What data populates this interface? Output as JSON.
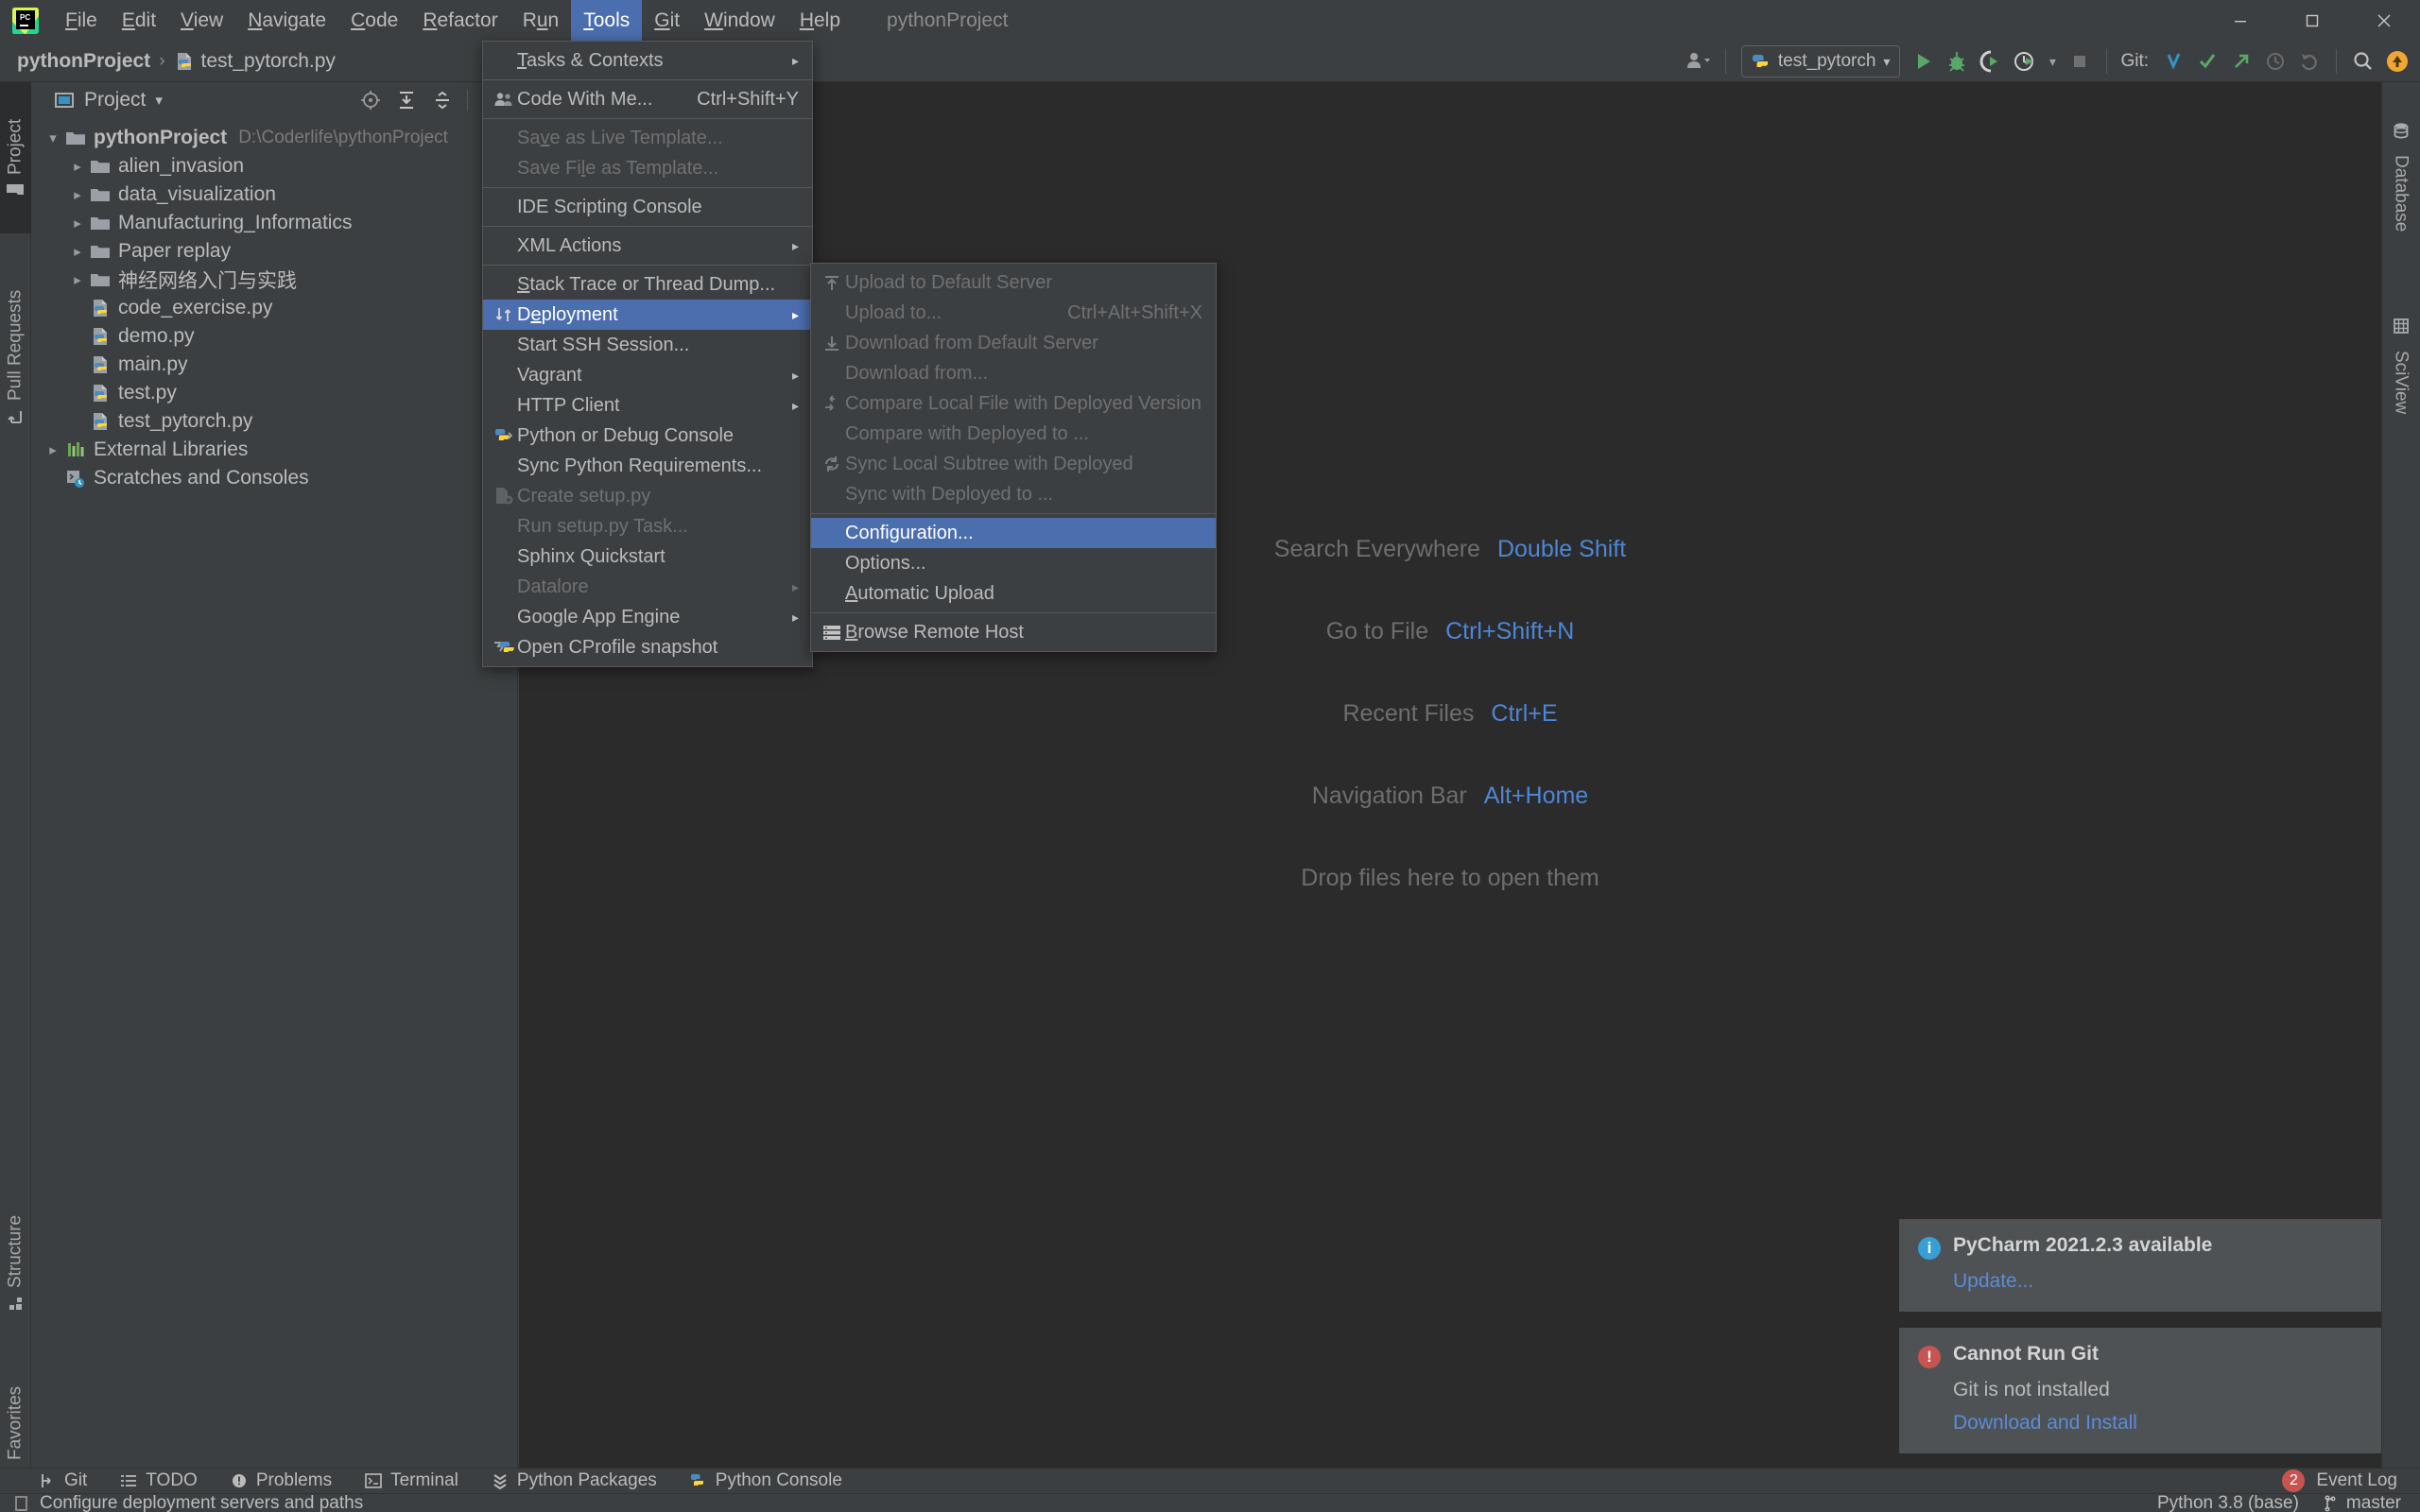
{
  "window": {
    "title": "pythonProject",
    "controls": [
      "minimize",
      "maximize",
      "close"
    ]
  },
  "menubar": {
    "items": [
      {
        "label": "File",
        "mnemonic": "F",
        "active": false
      },
      {
        "label": "Edit",
        "mnemonic": "E",
        "active": false
      },
      {
        "label": "View",
        "mnemonic": "V",
        "active": false
      },
      {
        "label": "Navigate",
        "mnemonic": "N",
        "active": false
      },
      {
        "label": "Code",
        "mnemonic": "C",
        "active": false
      },
      {
        "label": "Refactor",
        "mnemonic": "R",
        "active": false
      },
      {
        "label": "Run",
        "mnemonic": "u",
        "active": false
      },
      {
        "label": "Tools",
        "mnemonic": "T",
        "active": true
      },
      {
        "label": "Git",
        "mnemonic": "G",
        "active": false
      },
      {
        "label": "Window",
        "mnemonic": "W",
        "active": false
      },
      {
        "label": "Help",
        "mnemonic": "H",
        "active": false
      }
    ]
  },
  "breadcrumb": {
    "project": "pythonProject",
    "separator": "›",
    "file": "test_pytorch.py"
  },
  "toolbar": {
    "run_config": "test_pytorch",
    "git_label": "Git:",
    "icons": [
      "user-dropdown-icon",
      "run-icon",
      "debug-icon",
      "coverage-icon",
      "profile-icon",
      "stop-icon",
      "git-update-icon",
      "git-commit-icon",
      "git-push-icon",
      "git-history-icon",
      "git-rollback-icon",
      "search-everywhere-icon",
      "notifications-icon"
    ]
  },
  "left_strip": {
    "tabs": [
      {
        "label": "Project",
        "icon": "folder-icon",
        "selected": true
      },
      {
        "label": "Pull Requests",
        "icon": "pull-request-icon",
        "selected": false
      },
      {
        "label": "Structure",
        "icon": "structure-icon",
        "selected": false
      },
      {
        "label": "Favorites",
        "icon": "star-icon",
        "selected": false
      }
    ]
  },
  "right_strip": {
    "tabs": [
      {
        "label": "Database",
        "icon": "database-icon"
      },
      {
        "label": "SciView",
        "icon": "sciview-icon"
      }
    ]
  },
  "project_panel": {
    "header": "Project",
    "tools": [
      "locate-icon",
      "expand-all-icon",
      "collapse-all-icon",
      "settings-icon"
    ],
    "tree": [
      {
        "indent": 0,
        "arrow": "down",
        "icon": "folder-icon",
        "label": "pythonProject",
        "bold": true,
        "path": "D:\\Coderlife\\pythonProject"
      },
      {
        "indent": 1,
        "arrow": "right",
        "icon": "folder-icon",
        "label": "alien_invasion",
        "bold": false,
        "path": ""
      },
      {
        "indent": 1,
        "arrow": "right",
        "icon": "folder-icon",
        "label": "data_visualization",
        "bold": false,
        "path": ""
      },
      {
        "indent": 1,
        "arrow": "right",
        "icon": "folder-icon",
        "label": "Manufacturing_Informatics",
        "bold": false,
        "path": ""
      },
      {
        "indent": 1,
        "arrow": "right",
        "icon": "folder-icon",
        "label": "Paper replay",
        "bold": false,
        "path": ""
      },
      {
        "indent": 1,
        "arrow": "right",
        "icon": "folder-icon",
        "label": "神经网络入门与实践",
        "bold": false,
        "path": ""
      },
      {
        "indent": 1,
        "arrow": "none",
        "icon": "python-file-icon",
        "label": "code_exercise.py",
        "bold": false,
        "path": ""
      },
      {
        "indent": 1,
        "arrow": "none",
        "icon": "python-file-icon",
        "label": "demo.py",
        "bold": false,
        "path": ""
      },
      {
        "indent": 1,
        "arrow": "none",
        "icon": "python-file-icon",
        "label": "main.py",
        "bold": false,
        "path": ""
      },
      {
        "indent": 1,
        "arrow": "none",
        "icon": "python-file-icon",
        "label": "test.py",
        "bold": false,
        "path": ""
      },
      {
        "indent": 1,
        "arrow": "none",
        "icon": "python-file-icon",
        "label": "test_pytorch.py",
        "bold": false,
        "path": ""
      },
      {
        "indent": 0,
        "arrow": "right",
        "icon": "library-icon",
        "label": "External Libraries",
        "bold": false,
        "path": ""
      },
      {
        "indent": 0,
        "arrow": "none",
        "icon": "scratches-icon",
        "label": "Scratches and Consoles",
        "bold": false,
        "path": ""
      }
    ]
  },
  "editor_hints": [
    {
      "label": "Search Everywhere",
      "key": "Double Shift"
    },
    {
      "label": "Go to File",
      "key": "Ctrl+Shift+N"
    },
    {
      "label": "Recent Files",
      "key": "Ctrl+E"
    },
    {
      "label": "Navigation Bar",
      "key": "Alt+Home"
    },
    {
      "label": "Drop files here to open them",
      "key": ""
    }
  ],
  "tools_menu": [
    {
      "label": "Tasks & Contexts",
      "mnemonic": "T",
      "icon": "",
      "shortcut": "",
      "submenu": true,
      "disabled": false,
      "selected": false,
      "separator_after": true
    },
    {
      "label": "Code With Me...",
      "mnemonic": "",
      "icon": "people-icon",
      "shortcut": "Ctrl+Shift+Y",
      "submenu": false,
      "disabled": false,
      "selected": false,
      "separator_after": true
    },
    {
      "label": "Save as Live Template...",
      "mnemonic": "v",
      "icon": "",
      "shortcut": "",
      "submenu": false,
      "disabled": true,
      "selected": false,
      "separator_after": false
    },
    {
      "label": "Save File as Template...",
      "mnemonic": "l",
      "icon": "",
      "shortcut": "",
      "submenu": false,
      "disabled": true,
      "selected": false,
      "separator_after": true
    },
    {
      "label": "IDE Scripting Console",
      "mnemonic": "",
      "icon": "",
      "shortcut": "",
      "submenu": false,
      "disabled": false,
      "selected": false,
      "separator_after": true
    },
    {
      "label": "XML Actions",
      "mnemonic": "",
      "icon": "",
      "shortcut": "",
      "submenu": true,
      "disabled": false,
      "selected": false,
      "separator_after": true
    },
    {
      "label": "Stack Trace or Thread Dump...",
      "mnemonic": "S",
      "icon": "",
      "shortcut": "",
      "submenu": false,
      "disabled": false,
      "selected": false,
      "separator_after": false
    },
    {
      "label": "Deployment",
      "mnemonic": "e",
      "icon": "deployment-icon",
      "shortcut": "",
      "submenu": true,
      "disabled": false,
      "selected": true,
      "separator_after": false
    },
    {
      "label": "Start SSH Session...",
      "mnemonic": "",
      "icon": "",
      "shortcut": "",
      "submenu": false,
      "disabled": false,
      "selected": false,
      "separator_after": false
    },
    {
      "label": "Vagrant",
      "mnemonic": "",
      "icon": "",
      "shortcut": "",
      "submenu": true,
      "disabled": false,
      "selected": false,
      "separator_after": false
    },
    {
      "label": "HTTP Client",
      "mnemonic": "",
      "icon": "",
      "shortcut": "",
      "submenu": true,
      "disabled": false,
      "selected": false,
      "separator_after": false
    },
    {
      "label": "Python or Debug Console",
      "mnemonic": "",
      "icon": "python-console-icon",
      "shortcut": "",
      "submenu": false,
      "disabled": false,
      "selected": false,
      "separator_after": false
    },
    {
      "label": "Sync Python Requirements...",
      "mnemonic": "",
      "icon": "",
      "shortcut": "",
      "submenu": false,
      "disabled": false,
      "selected": false,
      "separator_after": false
    },
    {
      "label": "Create setup.py",
      "mnemonic": "",
      "icon": "setup-py-icon",
      "shortcut": "",
      "submenu": false,
      "disabled": true,
      "selected": false,
      "separator_after": false
    },
    {
      "label": "Run setup.py Task...",
      "mnemonic": "",
      "icon": "",
      "shortcut": "",
      "submenu": false,
      "disabled": true,
      "selected": false,
      "separator_after": false
    },
    {
      "label": "Sphinx Quickstart",
      "mnemonic": "",
      "icon": "",
      "shortcut": "",
      "submenu": false,
      "disabled": false,
      "selected": false,
      "separator_after": false
    },
    {
      "label": "Datalore",
      "mnemonic": "",
      "icon": "",
      "shortcut": "",
      "submenu": true,
      "disabled": true,
      "selected": false,
      "separator_after": false
    },
    {
      "label": "Google App Engine",
      "mnemonic": "",
      "icon": "",
      "shortcut": "",
      "submenu": true,
      "disabled": false,
      "selected": false,
      "separator_after": false
    },
    {
      "label": "Open CProfile snapshot",
      "mnemonic": "",
      "icon": "cprofile-icon",
      "shortcut": "",
      "submenu": false,
      "disabled": false,
      "selected": false,
      "separator_after": false
    }
  ],
  "deployment_menu": [
    {
      "label": "Upload to Default Server",
      "mnemonic": "",
      "icon": "upload-icon",
      "shortcut": "",
      "disabled": true,
      "selected": false,
      "separator_after": false
    },
    {
      "label": "Upload to...",
      "mnemonic": "",
      "icon": "",
      "shortcut": "Ctrl+Alt+Shift+X",
      "disabled": true,
      "selected": false,
      "separator_after": false
    },
    {
      "label": "Download from Default Server",
      "mnemonic": "",
      "icon": "download-icon",
      "shortcut": "",
      "disabled": true,
      "selected": false,
      "separator_after": false
    },
    {
      "label": "Download from...",
      "mnemonic": "",
      "icon": "",
      "shortcut": "",
      "disabled": true,
      "selected": false,
      "separator_after": false
    },
    {
      "label": "Compare Local File with Deployed Version",
      "mnemonic": "",
      "icon": "compare-icon",
      "shortcut": "",
      "disabled": true,
      "selected": false,
      "separator_after": false
    },
    {
      "label": "Compare with Deployed to ...",
      "mnemonic": "",
      "icon": "",
      "shortcut": "",
      "disabled": true,
      "selected": false,
      "separator_after": false
    },
    {
      "label": "Sync Local Subtree with Deployed",
      "mnemonic": "",
      "icon": "sync-icon",
      "shortcut": "",
      "disabled": true,
      "selected": false,
      "separator_after": false
    },
    {
      "label": "Sync with Deployed to ...",
      "mnemonic": "",
      "icon": "",
      "shortcut": "",
      "disabled": true,
      "selected": false,
      "separator_after": true
    },
    {
      "label": "Configuration...",
      "mnemonic": "",
      "icon": "",
      "shortcut": "",
      "disabled": false,
      "selected": true,
      "separator_after": false
    },
    {
      "label": "Options...",
      "mnemonic": "",
      "icon": "",
      "shortcut": "",
      "disabled": false,
      "selected": false,
      "separator_after": false
    },
    {
      "label": "Automatic Upload",
      "mnemonic": "A",
      "icon": "",
      "shortcut": "",
      "disabled": false,
      "selected": false,
      "separator_after": true
    },
    {
      "label": "Browse Remote Host",
      "mnemonic": "B",
      "icon": "remote-host-icon",
      "shortcut": "",
      "disabled": false,
      "selected": false,
      "separator_after": false
    }
  ],
  "notifications": [
    {
      "type": "info",
      "title": "PyCharm 2021.2.3 available",
      "body": "",
      "link": "Update...",
      "color": "#389fd6"
    },
    {
      "type": "error",
      "title": "Cannot Run Git",
      "body": "Git is not installed",
      "link": "Download and Install",
      "color": "#c75450"
    }
  ],
  "bottom_bar": {
    "items": [
      {
        "label": "Git",
        "icon": "git-icon"
      },
      {
        "label": "TODO",
        "icon": "todo-icon"
      },
      {
        "label": "Problems",
        "icon": "problems-icon"
      },
      {
        "label": "Terminal",
        "icon": "terminal-icon"
      },
      {
        "label": "Python Packages",
        "icon": "packages-icon"
      },
      {
        "label": "Python Console",
        "icon": "python-console-icon"
      }
    ],
    "event_log": {
      "label": "Event Log",
      "count": "2"
    }
  },
  "status_bar": {
    "message": "Configure deployment servers and paths",
    "interpreter": "Python 3.8 (base)",
    "branch": "master"
  },
  "colors": {
    "accent_selection": "#4b6eaf",
    "panel_bg": "#3c3f41",
    "editor_bg": "#2b2b2b",
    "text": "#bbbbbb",
    "link": "#5b8cd6"
  }
}
